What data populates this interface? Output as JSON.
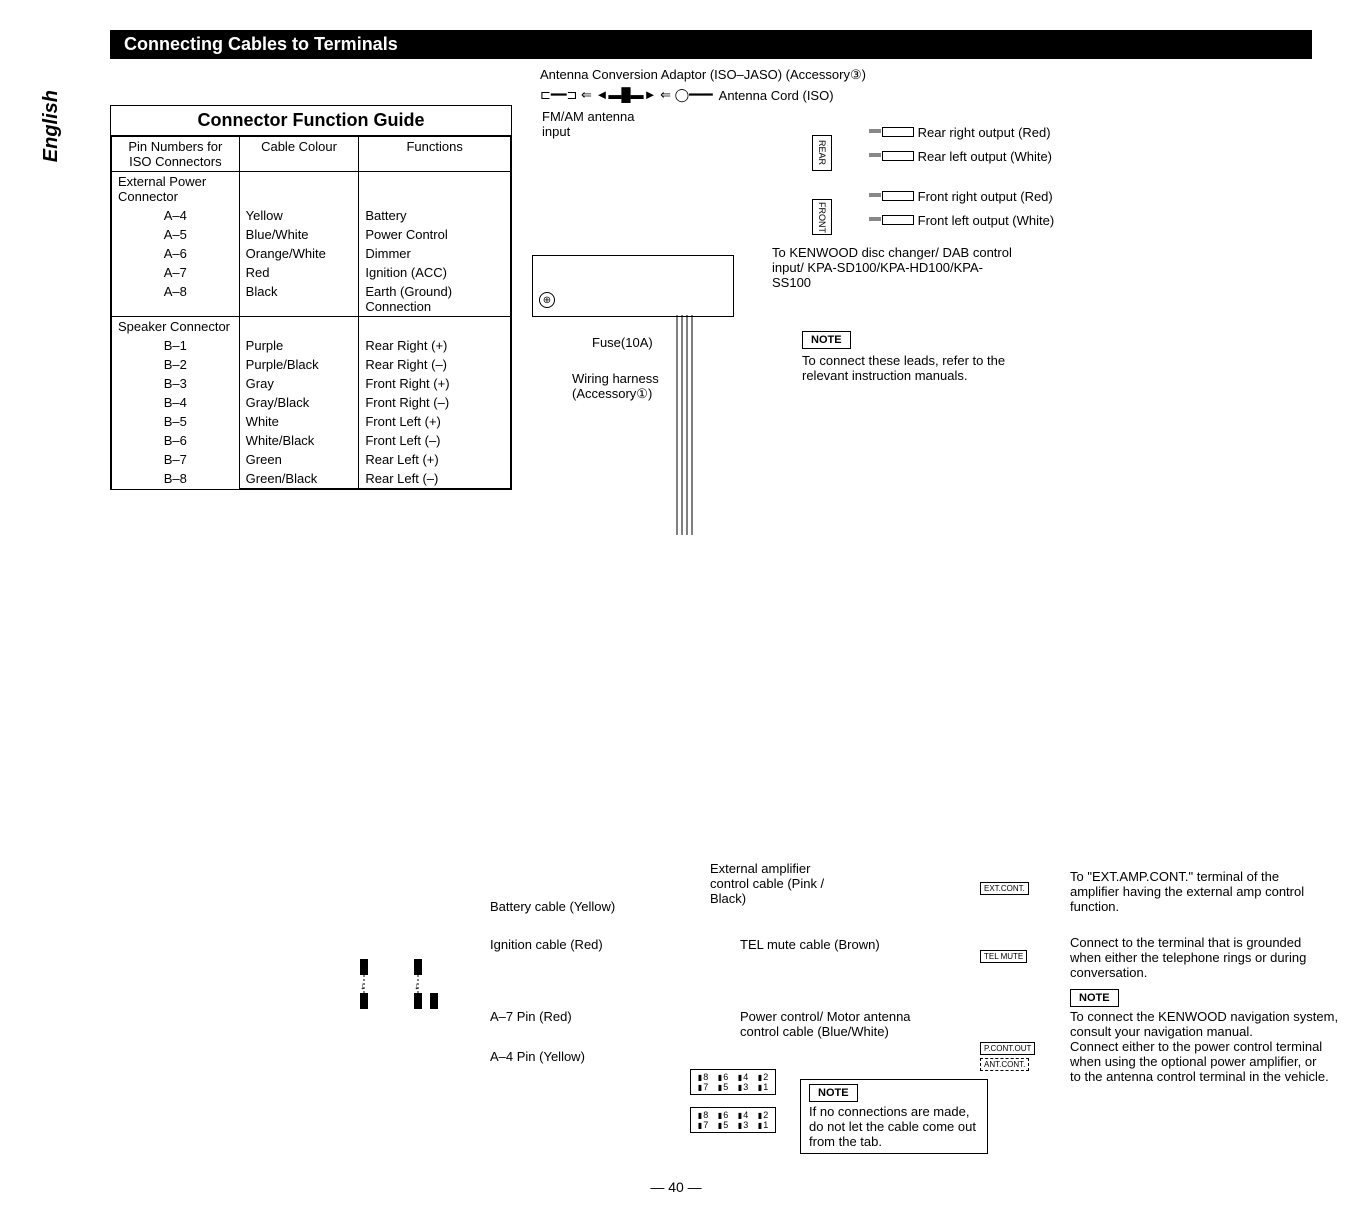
{
  "sideTab": "English",
  "titleBar": "Connecting Cables to Terminals",
  "topLabel": "Antenna Conversion Adaptor (ISO–JASO) (Accessory③)",
  "antennaCord": "Antenna Cord (ISO)",
  "table": {
    "title": "Connector Function Guide",
    "headers": {
      "col1": "Pin Numbers for ISO Connectors",
      "col2": "Cable Colour",
      "col3": "Functions"
    },
    "sectionA": {
      "name": "External Power Connector",
      "rows": [
        {
          "pin": "A–4",
          "colour": "Yellow",
          "func": "Battery"
        },
        {
          "pin": "A–5",
          "colour": "Blue/White",
          "func": "Power Control"
        },
        {
          "pin": "A–6",
          "colour": "Orange/White",
          "func": "Dimmer"
        },
        {
          "pin": "A–7",
          "colour": "Red",
          "func": "Ignition (ACC)"
        },
        {
          "pin": "A–8",
          "colour": "Black",
          "func": "Earth (Ground) Connection"
        }
      ]
    },
    "sectionB": {
      "name": "Speaker Connector",
      "rows": [
        {
          "pin": "B–1",
          "colour": "Purple",
          "func": "Rear Right (+)"
        },
        {
          "pin": "B–2",
          "colour": "Purple/Black",
          "func": "Rear Right (–)"
        },
        {
          "pin": "B–3",
          "colour": "Gray",
          "func": "Front Right (+)"
        },
        {
          "pin": "B–4",
          "colour": "Gray/Black",
          "func": "Front Right (–)"
        },
        {
          "pin": "B–5",
          "colour": "White",
          "func": "Front Left (+)"
        },
        {
          "pin": "B–6",
          "colour": "White/Black",
          "func": "Front Left (–)"
        },
        {
          "pin": "B–7",
          "colour": "Green",
          "func": "Rear Left (+)"
        },
        {
          "pin": "B–8",
          "colour": "Green/Black",
          "func": "Rear Left (–)"
        }
      ]
    }
  },
  "diagram": {
    "fmam": "FM/AM antenna input",
    "rearBox": "REAR",
    "frontBox": "FRONT",
    "rearRight": "Rear right output (Red)",
    "rearLeft": "Rear left output (White)",
    "frontRight": "Front right output (Red)",
    "frontLeft": "Front left output (White)",
    "kenwood": "To KENWOOD disc changer/ DAB control input/ KPA-SD100/KPA-HD100/KPA-SS100",
    "fuse": "Fuse(10A)",
    "harness": "Wiring harness (Accessory①)",
    "noteLabel": "NOTE",
    "note1": "To connect these leads, refer to the relevant instruction manuals.",
    "extAmpCable": "External amplifier control cable (Pink / Black)",
    "extCont": "EXT.CONT.",
    "extAmpText": "To \"EXT.AMP.CONT.\" terminal of the amplifier having the external amp control function.",
    "telMuteCable": "TEL mute cable (Brown)",
    "telMute": "TEL MUTE",
    "telMuteText": "Connect to the terminal that is grounded when either the telephone rings or during conversation.",
    "navNote": "To connect the KENWOOD navigation system, consult your navigation manual.",
    "powerCable": "Power control/ Motor antenna control cable (Blue/White)",
    "pcont": "P.CONT.OUT",
    "antcont": "ANT.CONT.",
    "powerText": "Connect either to the power control terminal when using the optional power amplifier, or to the antenna control terminal in the vehicle.",
    "batteryCable": "Battery cable (Yellow)",
    "ignitionCable": "Ignition cable (Red)",
    "a7pin": "A–7 Pin (Red)",
    "a4pin": "A–4 Pin (Yellow)",
    "isoNote": "If no connections are made, do not let the cable come out from the tab."
  },
  "pageNum": "— 40 —"
}
